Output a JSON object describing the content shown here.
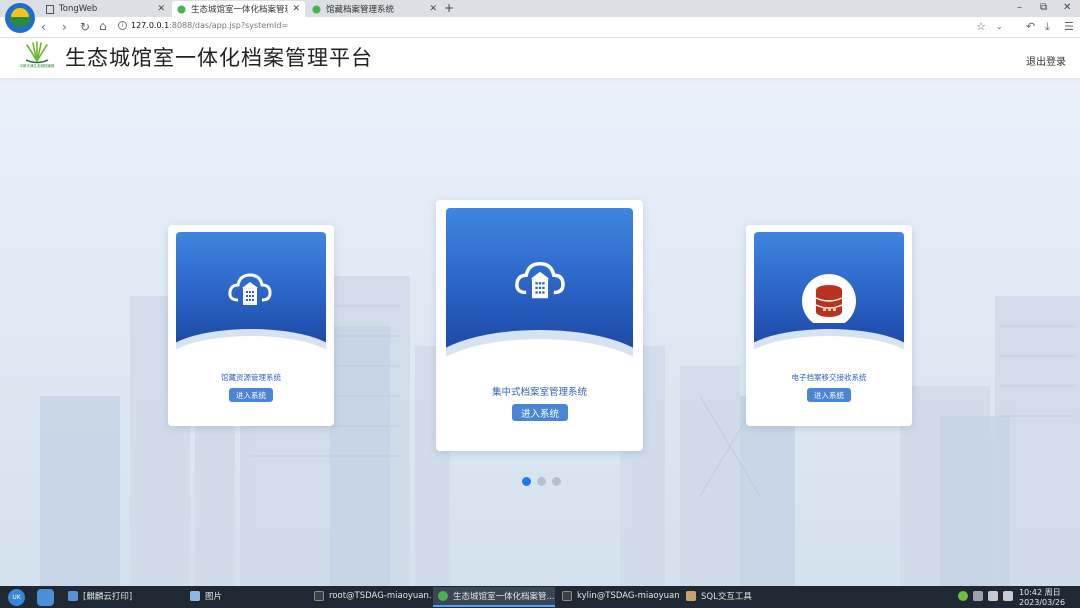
{
  "browser": {
    "tabs": [
      {
        "title": "TongWeb",
        "icon": "page-icon"
      },
      {
        "title": "生态城馆室一体化档案管理",
        "icon": "app-leaf-icon"
      },
      {
        "title": "馆藏档案管理系统",
        "icon": "app-leaf-icon"
      }
    ],
    "url_host": "127.0.0.1",
    "url_rest": ":8088/das/app.jsp?systemId="
  },
  "header": {
    "title": "生态城馆室一体化档案管理平台",
    "logout_label": "退出登录",
    "logo_caption": "中新天津生态城档案馆"
  },
  "cards": [
    {
      "title": "馆藏资源管理系统",
      "button": "进入系统",
      "icon": "cloud-building-icon"
    },
    {
      "title": "集中式档案室管理系统",
      "button": "进入系统",
      "icon": "cloud-building-icon"
    },
    {
      "title": "电子档案移交接收系统",
      "button": "进入系统",
      "icon": "database-icon"
    }
  ],
  "carousel": {
    "count": 3,
    "active_index": 0
  },
  "taskbar": {
    "items": [
      {
        "label": "[麒麟云打印]"
      },
      {
        "label": "图片"
      },
      {
        "label": "root@TSDAG-miaoyuan..."
      },
      {
        "label": "生态城馆室一体化档案管..."
      },
      {
        "label": "kylin@TSDAG-miaoyuan..."
      },
      {
        "label": "SQL交互工具"
      }
    ],
    "clock_time": "10:42 周日",
    "clock_date": "2023/03/26"
  },
  "colors": {
    "accent": "#2a62c4",
    "button": "#4a86d6",
    "dot_active": "#1a7de8"
  }
}
